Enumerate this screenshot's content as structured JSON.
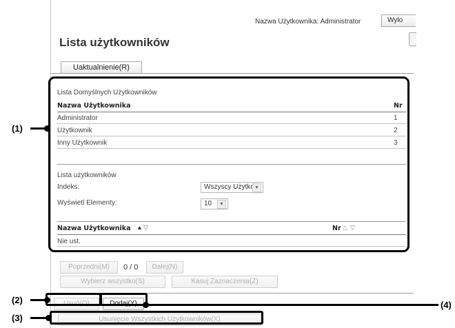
{
  "header": {
    "user_label": "Nazwa Użytkownika: Administrator",
    "logout_button": "Wylo"
  },
  "page_title": "Lista użytkowników",
  "update_button": "Uaktualnienie(R)",
  "default_users": {
    "section_label": "Lista Domyślnych Użytkowników",
    "col_name": "Nazwa Użytkownika",
    "col_no": "Nr",
    "rows": [
      {
        "name": "Administrator",
        "no": "1"
      },
      {
        "name": "Użytkownik",
        "no": "2"
      },
      {
        "name": "Inny Użytkownik",
        "no": "3"
      }
    ]
  },
  "user_list": {
    "section_label": "Lista użytkowników",
    "index_label": "Indeks:",
    "index_value": "Wszyscy Użytkow.",
    "display_label": "Wyświetl Elementy:",
    "display_value": "10",
    "col_name": "Nazwa Użytkownika",
    "col_no": "Nr",
    "empty_row": "Nie ust."
  },
  "pager": {
    "prev": "Poprzedni(M)",
    "count": "0 / 0",
    "next": "Dalej(N)",
    "select_all": "Wybierz wszystko(S)",
    "clear": "Kasuj Zaznaczenia(Z)"
  },
  "actions": {
    "delete": "Usuń(O)",
    "add": "Dodaj(Y)",
    "delete_all": "Usunięcie Wszystkich Użytkowników(X)"
  },
  "callouts": {
    "c1": "(1)",
    "c2": "(2)",
    "c3": "(3)",
    "c4": "(4)"
  }
}
